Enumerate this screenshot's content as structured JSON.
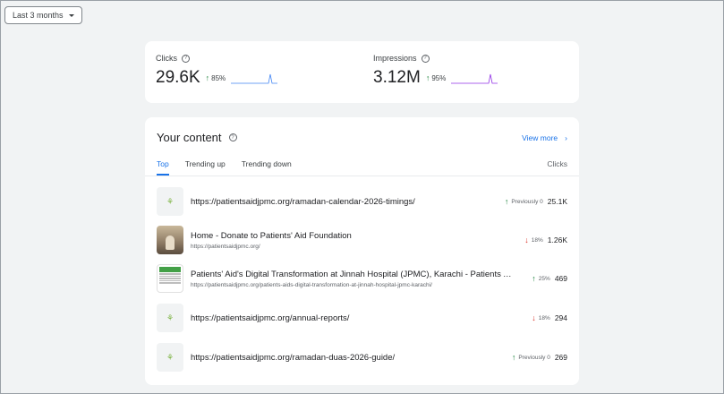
{
  "date_range": {
    "label": "Last 3 months"
  },
  "metrics": {
    "clicks": {
      "label": "Clicks",
      "value": "29.6K",
      "change": "85%"
    },
    "impressions": {
      "label": "Impressions",
      "value": "3.12M",
      "change": "95%"
    }
  },
  "colors": {
    "clicks_line": "#4285f4",
    "impressions_line": "#9334e6",
    "accent": "#1a73e8",
    "up": "#188038",
    "down": "#d93025"
  },
  "content": {
    "title": "Your content",
    "view_more": "View more",
    "tabs": [
      "Top",
      "Trending up",
      "Trending down"
    ],
    "column_header": "Clicks",
    "rows": [
      {
        "title": "https://patientsaidjpmc.org/ramadan-calendar-2026-timings/",
        "subtitle": "",
        "change": "Previously 0",
        "direction": "up",
        "clicks": "25.1K",
        "thumb": "sprout-icon"
      },
      {
        "title": "Home - Donate to Patients' Aid Foundation",
        "subtitle": "https://patientsaidjpmc.org/",
        "change": "18%",
        "direction": "down",
        "clicks": "1.26K",
        "thumb": "photo"
      },
      {
        "title": "Patients' Aid's Digital Transformation at Jinnah Hospital (JPMC), Karachi - Patients Aid Foundation",
        "subtitle": "https://patientsaidjpmc.org/patients-aids-digital-transformation-at-jinnah-hospital-jpmc-karachi/",
        "change": "25%",
        "direction": "up",
        "clicks": "469",
        "thumb": "document"
      },
      {
        "title": "https://patientsaidjpmc.org/annual-reports/",
        "subtitle": "",
        "change": "18%",
        "direction": "down",
        "clicks": "294",
        "thumb": "sprout-icon"
      },
      {
        "title": "https://patientsaidjpmc.org/ramadan-duas-2026-guide/",
        "subtitle": "",
        "change": "Previously 0",
        "direction": "up",
        "clicks": "269",
        "thumb": "sprout-icon"
      }
    ]
  }
}
